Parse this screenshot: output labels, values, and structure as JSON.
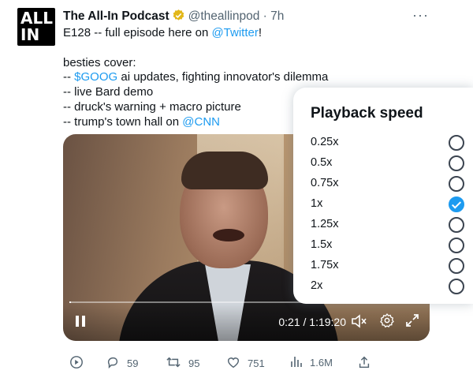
{
  "tweet": {
    "avatar_line1": "ALL",
    "avatar_line2": "IN",
    "display_name": "The All-In Podcast",
    "handle": "@theallinpod",
    "separator": "·",
    "time_ago": "7h",
    "more": "···",
    "line1_prefix": "E128 -- full episode here on ",
    "line1_link": "@Twitter",
    "line1_suffix": "!",
    "line2": "besties cover:",
    "line3_prefix": "-- ",
    "line3_link": "$GOOG",
    "line3_suffix": " ai updates, fighting innovator's dilemma",
    "line4": "-- live Bard demo",
    "line5": "-- druck's warning + macro picture",
    "line6_prefix": "-- trump's town hall on ",
    "line6_link": "@CNN"
  },
  "video": {
    "time_display": "0:21 / 1:19:20",
    "progress_fraction": 0.0044
  },
  "playback_menu": {
    "title": "Playback speed",
    "options": [
      {
        "label": "0.25x",
        "selected": false
      },
      {
        "label": "0.5x",
        "selected": false
      },
      {
        "label": "0.75x",
        "selected": false
      },
      {
        "label": "1x",
        "selected": true
      },
      {
        "label": "1.25x",
        "selected": false
      },
      {
        "label": "1.5x",
        "selected": false
      },
      {
        "label": "1.75x",
        "selected": false
      },
      {
        "label": "2x",
        "selected": false
      }
    ]
  },
  "actions": {
    "replies": "59",
    "retweets": "95",
    "likes": "751",
    "views": "1.6M"
  },
  "colors": {
    "accent": "#1d9bf0",
    "verified_gold": "#e2b719",
    "muted_text": "#536471"
  },
  "icons": [
    "verified-badge-icon",
    "more-icon",
    "pause-icon",
    "mute-icon",
    "gear-icon",
    "expand-icon",
    "play-circle-icon",
    "reply-icon",
    "retweet-icon",
    "like-icon",
    "views-icon",
    "share-icon"
  ]
}
